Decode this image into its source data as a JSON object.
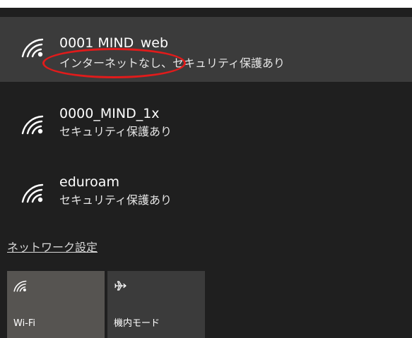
{
  "networks": [
    {
      "ssid": "0001 MIND_web",
      "status": "インターネットなし、セキュリティ保護あり",
      "icon": "wifi-secured-icon"
    },
    {
      "ssid": "0000_MIND_1x",
      "status": "セキュリティ保護あり",
      "icon": "wifi-secured-icon"
    },
    {
      "ssid": "eduroam",
      "status": "セキュリティ保護あり",
      "icon": "wifi-secured-icon"
    }
  ],
  "network_settings_label": "ネットワーク設定",
  "quick_actions": [
    {
      "label": "Wi-Fi",
      "icon": "wifi-icon"
    },
    {
      "label": "機内モード",
      "icon": "airplane-icon"
    }
  ],
  "colors": {
    "panel_bg": "#1f1f1f",
    "selected_bg": "#3b3b3b",
    "wifi_tile_bg": "#565451",
    "annotation": "#e11b1b"
  }
}
